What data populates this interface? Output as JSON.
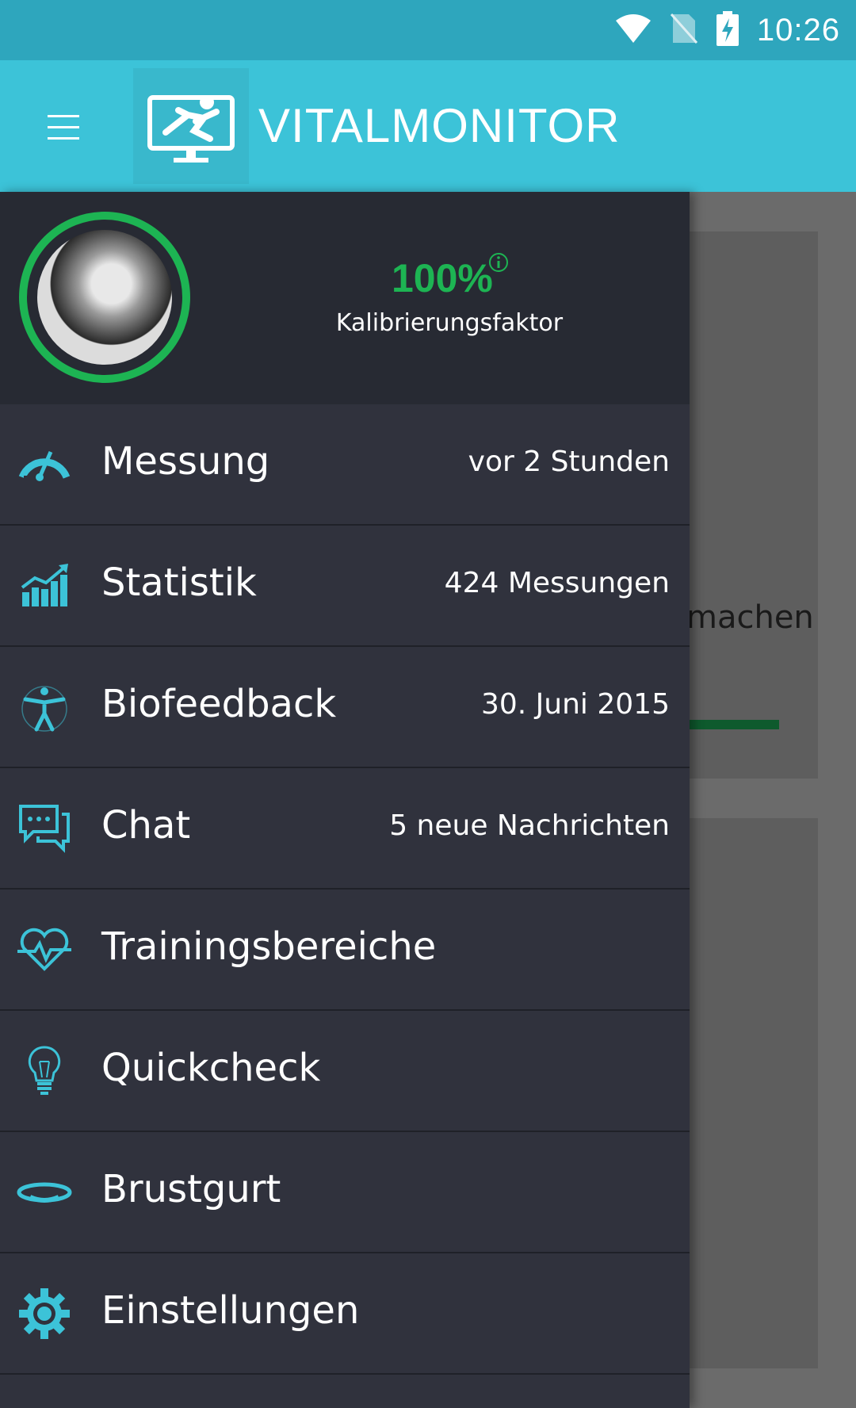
{
  "status_bar": {
    "time": "10:26"
  },
  "app_bar": {
    "title": "VITALMONITOR"
  },
  "background": {
    "partial_text": "machen"
  },
  "profile": {
    "calibration_value": "100%",
    "calibration_label": "Kalibrierungsfaktor"
  },
  "menu": {
    "items": [
      {
        "label": "Messung",
        "value": "vor 2 Stunden",
        "icon": "speedometer-icon"
      },
      {
        "label": "Statistik",
        "value": "424 Messungen",
        "icon": "bar-chart-icon"
      },
      {
        "label": "Biofeedback",
        "value": "30. Juni 2015",
        "icon": "human-figure-icon"
      },
      {
        "label": "Chat",
        "value": "5 neue Nachrichten",
        "icon": "chat-icon"
      },
      {
        "label": "Trainingsbereiche",
        "value": "",
        "icon": "heart-pulse-icon"
      },
      {
        "label": "Quickcheck",
        "value": "",
        "icon": "lightbulb-icon"
      },
      {
        "label": "Brustgurt",
        "value": "",
        "icon": "chest-strap-icon"
      },
      {
        "label": "Einstellungen",
        "value": "",
        "icon": "gear-icon"
      }
    ]
  },
  "colors": {
    "status_bar": "#2ea6bd",
    "app_bar": "#3cc3d8",
    "drawer": "#30323d",
    "profile_bg": "#272a33",
    "accent_green": "#1db453",
    "icon_blue": "#3cc3d8"
  }
}
